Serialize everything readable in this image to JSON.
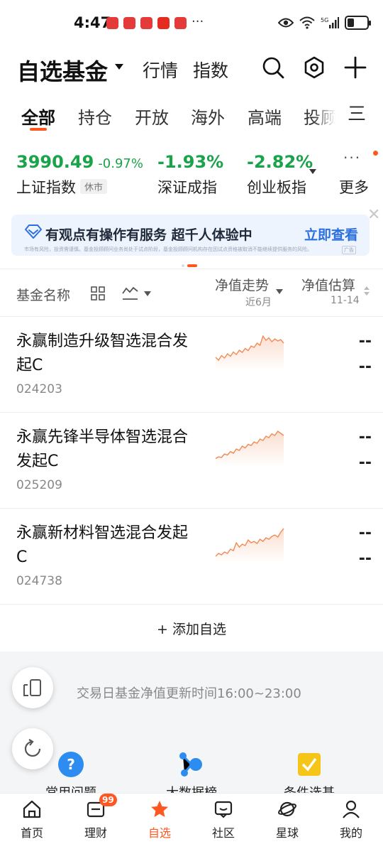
{
  "status_bar": {
    "time": "4:47",
    "overflow": "···",
    "network": "5G",
    "battery_level": 0.35,
    "icons": [
      "eye-icon",
      "wifi-icon",
      "signal-icon",
      "battery-icon"
    ]
  },
  "header": {
    "title": "自选基金",
    "nav": [
      "行情",
      "指数"
    ],
    "icons": [
      "search-icon",
      "settings-icon",
      "plus-icon"
    ]
  },
  "tabs": {
    "items": [
      "全部",
      "持仓",
      "开放",
      "海外",
      "高端",
      "投顾"
    ],
    "active_index": 0,
    "menu": "三"
  },
  "indices": [
    {
      "value": "3990.49",
      "change": "-0.97%",
      "name": "上证指数",
      "badge": "休市"
    },
    {
      "value": "-1.93%",
      "name": "深证成指"
    },
    {
      "value": "-2.82%",
      "name": "创业板指"
    }
  ],
  "indices_more": {
    "dots": "···",
    "label": "更多"
  },
  "banner": {
    "text": "有观点有操作有服务 超千人体验中",
    "cta": "立即查看",
    "fine_print": "市场有风险，投资需谨慎。基金投顾顾问业务尚处于试点阶段，基金投顾顾问机构存在因试点资格被取消不能继续提供服务的风险。",
    "ad": "广告",
    "close": "✕"
  },
  "columns": {
    "name": "基金名称",
    "nav_trend": "净值走势",
    "nav_trend_sub": "近6月",
    "estimate": "净值估算",
    "estimate_sub": "11-14"
  },
  "funds": [
    {
      "name": "永赢制造升级智选混合发起C",
      "code": "024203",
      "v1": "--",
      "v2": "--",
      "trend": [
        0.3,
        0.22,
        0.35,
        0.28,
        0.4,
        0.33,
        0.45,
        0.38,
        0.5,
        0.44,
        0.55,
        0.49,
        0.62,
        0.58,
        0.7,
        0.64,
        0.9,
        0.78,
        0.85,
        0.74,
        0.82,
        0.76,
        0.8,
        0.7
      ]
    },
    {
      "name": "永赢先锋半导体智选混合发起C",
      "code": "025209",
      "v1": "--",
      "v2": "--",
      "trend": [
        0.15,
        0.2,
        0.18,
        0.28,
        0.25,
        0.35,
        0.3,
        0.42,
        0.38,
        0.5,
        0.45,
        0.55,
        0.52,
        0.62,
        0.58,
        0.7,
        0.66,
        0.78,
        0.74,
        0.85,
        0.8,
        0.92,
        0.86,
        0.8
      ]
    },
    {
      "name": "永赢新材料智选混合发起C",
      "code": "024738",
      "v1": "--",
      "v2": "--",
      "trend": [
        0.1,
        0.18,
        0.14,
        0.22,
        0.18,
        0.3,
        0.26,
        0.48,
        0.36,
        0.44,
        0.4,
        0.56,
        0.48,
        0.52,
        0.46,
        0.58,
        0.52,
        0.62,
        0.58,
        0.66,
        0.7,
        0.64,
        0.78,
        0.88
      ]
    }
  ],
  "add": "+ 添加自选",
  "notice": "交易日基金净值更新时间16:00~23:00",
  "quick_links": [
    "常用问题",
    "大数据榜",
    "条件选基"
  ],
  "bottom_nav": [
    {
      "label": "首页",
      "icon": "home-icon"
    },
    {
      "label": "理财",
      "icon": "wallet-icon",
      "badge": "99"
    },
    {
      "label": "自选",
      "icon": "star-icon",
      "active": true
    },
    {
      "label": "社区",
      "icon": "chat-icon"
    },
    {
      "label": "星球",
      "icon": "planet-icon"
    },
    {
      "label": "我的",
      "icon": "user-icon"
    }
  ],
  "colors": {
    "accent": "#ff5722",
    "down": "#1aa34a",
    "link": "#2a6fe0",
    "spark_line": "#f08a55"
  }
}
